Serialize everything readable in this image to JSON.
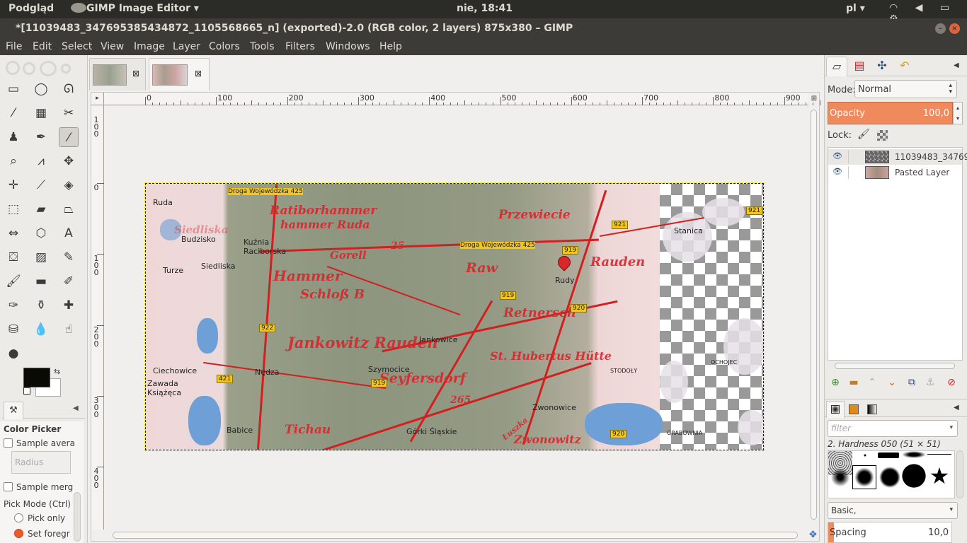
{
  "system_bar": {
    "left_label": "Podgląd",
    "app_name": "GIMP Image Editor ▾",
    "clock": "nie, 18:41",
    "language": "pl ▾",
    "tray_icons": [
      "wifi-icon",
      "volume-icon",
      "battery-icon",
      "gear-icon"
    ],
    "tray_glyphs": "◠ ◀ ▭ ⚙"
  },
  "window": {
    "title": "*[11039483_347695385434872_1105568665_n] (exported)-2.0 (RGB color, 2 layers) 875x380 – GIMP",
    "minimize": "–",
    "close": "×"
  },
  "menu": [
    "File",
    "Edit",
    "Select",
    "View",
    "Image",
    "Layer",
    "Colors",
    "Tools",
    "Filters",
    "Windows",
    "Help"
  ],
  "toolbox": {
    "tools": [
      {
        "name": "rect-select-icon",
        "glyph": "▭"
      },
      {
        "name": "ellipse-select-icon",
        "glyph": "◯"
      },
      {
        "name": "free-select-icon",
        "glyph": "ᘏ"
      },
      {
        "name": "fuzzy-select-icon",
        "glyph": "⁄"
      },
      {
        "name": "color-select-icon",
        "glyph": "▦"
      },
      {
        "name": "scissors-icon",
        "glyph": "✂"
      },
      {
        "name": "foreground-select-icon",
        "glyph": "♟"
      },
      {
        "name": "paths-icon",
        "glyph": "✒"
      },
      {
        "name": "color-picker-icon",
        "glyph": "⁄"
      },
      {
        "name": "zoom-icon",
        "glyph": "⌕"
      },
      {
        "name": "measure-icon",
        "glyph": "⩘"
      },
      {
        "name": "move-icon",
        "glyph": "✥"
      },
      {
        "name": "align-icon",
        "glyph": "✛"
      },
      {
        "name": "crop-icon",
        "glyph": "⟋"
      },
      {
        "name": "rotate-icon",
        "glyph": "◈"
      },
      {
        "name": "scale-icon",
        "glyph": "⬚"
      },
      {
        "name": "shear-icon",
        "glyph": "▰"
      },
      {
        "name": "perspective-icon",
        "glyph": "⏢"
      },
      {
        "name": "flip-icon",
        "glyph": "⇔"
      },
      {
        "name": "cage-icon",
        "glyph": "⬡"
      },
      {
        "name": "text-icon",
        "glyph": "A"
      },
      {
        "name": "bucket-fill-icon",
        "glyph": "⛋"
      },
      {
        "name": "blend-icon",
        "glyph": "▨"
      },
      {
        "name": "pencil-icon",
        "glyph": "✎"
      },
      {
        "name": "paintbrush-icon",
        "glyph": "🖌"
      },
      {
        "name": "eraser-icon",
        "glyph": "▬"
      },
      {
        "name": "airbrush-icon",
        "glyph": "✐"
      },
      {
        "name": "ink-icon",
        "glyph": "✑"
      },
      {
        "name": "clone-icon",
        "glyph": "⚱"
      },
      {
        "name": "heal-icon",
        "glyph": "✚"
      },
      {
        "name": "perspective-clone-icon",
        "glyph": "⛁"
      },
      {
        "name": "blur-icon",
        "glyph": "💧"
      },
      {
        "name": "smudge-icon",
        "glyph": "☝"
      },
      {
        "name": "dodge-burn-icon",
        "glyph": "●"
      }
    ],
    "selected_tool": 8,
    "swap_glyph": "⇆",
    "colors": {
      "foreground": "#0a0a05",
      "background": "#ffffff"
    }
  },
  "tool_options": {
    "tab_glyph": "⚒",
    "config_glyph": "◀",
    "title": "Color Picker",
    "sample_average": "Sample avera",
    "radius_placeholder": "Radius",
    "sample_merged": "Sample merg",
    "pick_mode_label": "Pick Mode  (Ctrl)",
    "pick_only": "Pick only",
    "set_foreground": "Set foregr"
  },
  "image_tabs": [
    {
      "close": "⊠",
      "active": false
    },
    {
      "close": "⊠",
      "active": true
    }
  ],
  "rulers": {
    "h_labels": [
      "0",
      "100",
      "200",
      "300",
      "400",
      "500",
      "600",
      "700",
      "800",
      "900"
    ],
    "v_labels": [
      "0",
      "1\n0\n0",
      "2\n0\n0",
      "3\n0\n0",
      "4\n0\n0"
    ],
    "top_v_labels": [
      "1\n0\n0"
    ]
  },
  "map": {
    "places": [
      "Ruda",
      "Budzisko",
      "Kuźnia\nRaciborska",
      "Turze",
      "Siedliska",
      "Ciechowice",
      "Nędza",
      "Zawada\nKsiążęca",
      "Babice",
      "Szymocice",
      "Jankowice",
      "Rudy",
      "Zwonowice",
      "Górki Śląskie",
      "Stanica",
      "OCHOJEC",
      "GRABOWNIA",
      "STODOŁY"
    ],
    "shields": [
      "Droga Wojewódzka 425",
      "Droga Wojewódzka 425",
      "921",
      "919",
      "919",
      "920",
      "922",
      "421",
      "919",
      "920",
      "921"
    ],
    "gothic": [
      "Ratiborhammer",
      "hammer Ruda",
      "Hammer",
      "Schloß B",
      "Jankowitz Rauden",
      "Przewiecie",
      "Raw",
      "Retnersch",
      "Rauden",
      "St. Hubertus Hütte",
      "Seyfersdorf",
      "Zwonowitz",
      "Gorell",
      "265",
      "25",
      "Tichau",
      "Łuszka",
      "Siedliska"
    ]
  },
  "layers_panel": {
    "tab_icons": [
      "layers-icon",
      "channels-icon",
      "paths-icon",
      "undo-icon"
    ],
    "tab_glyphs": [
      "▱",
      "▤",
      "✣",
      "↶"
    ],
    "config_glyph": "◀",
    "mode_label": "Mode:",
    "mode_value": "Normal",
    "spin_glyph": "▴\n▾",
    "opacity_label": "Opacity",
    "opacity_value": "100,0",
    "lock_label": "Lock:",
    "lock_pixels_glyph": "🖌",
    "layers": [
      {
        "name": "11039483_34769",
        "visible": true
      },
      {
        "name": "Pasted Layer",
        "visible": true
      }
    ],
    "eye_glyph": "👁",
    "buttons": [
      "new-layer-icon",
      "layer-group-icon",
      "raise-layer-icon",
      "lower-layer-icon",
      "duplicate-layer-icon",
      "anchor-icon",
      "delete-layer-icon"
    ],
    "button_glyphs": [
      "⊕",
      "▬",
      "⌃",
      "⌄",
      "⧉",
      "⚓",
      "⊘"
    ]
  },
  "brushes_panel": {
    "config_glyph": "◀",
    "filter_placeholder": "filter",
    "brush_name": "2. Hardness 050 (51 × 51)",
    "preset": "Basic,",
    "spacing_label": "Spacing",
    "spacing_value": "10,0",
    "dropdown_arrow": "▾"
  }
}
